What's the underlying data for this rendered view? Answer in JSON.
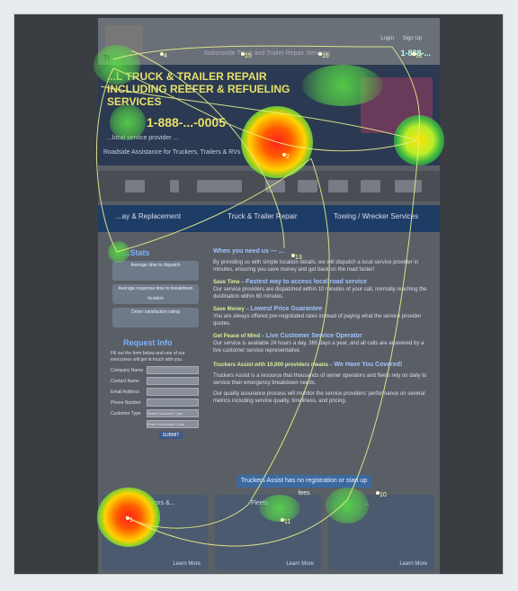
{
  "header": {
    "logo_text": "Tr",
    "login": "Login",
    "signup": "Sign Up",
    "tagline": "Nationwide Truck and Trailer Repair Services",
    "phone": "1-888-..."
  },
  "hero": {
    "title_line1": "...L TRUCK & TRAILER REPAIR",
    "title_line2": "INCLUDING REEFER & REFUELING SERVICES",
    "phone": "1-888-...-0005",
    "sub": "...local service provider ...",
    "road": "Roadside Assistance for Truckers, Trailers & RVs"
  },
  "services": {
    "item1": "...ay & Replacement",
    "item2": "Truck & Trailer Repair",
    "item3": "Towing / Wrecker Services"
  },
  "sidebar": {
    "stats_title": "...Stats",
    "stat1": "Average time to dispatch",
    "stat2": "Average response time to breakdown location",
    "stat3": "Driver satisfaction rating",
    "request_title": "Request Info",
    "request_note": "Fill out the form below and one of our executives will get in touch with you.",
    "fields": [
      "Company Name",
      "Contact Name",
      "Email Address",
      "Phone Number",
      "Customer Type"
    ],
    "select_value": "Select Customer Type",
    "captcha": "Enter Verification Code",
    "submit": "SUBMIT"
  },
  "content": {
    "heading": "When you need us — ...",
    "intro": "By providing us with simple location details, we will dispatch a local service provider in minutes, ensuring you save money and get back on the road faster!",
    "b1_title": "Save Time",
    "b1_link": "Fastest way to access local road service",
    "b1_text": "Our service providers are dispatched within 10 minutes of your call, normally reaching the destination within 60 minutes.",
    "b2_title": "Save Money",
    "b2_link": "Lowest Price Guarantee",
    "b2_text": "You are always offered pre-negotiated rates instead of paying what the service provider quotes.",
    "b3_title": "Get Peace of Mind",
    "b3_link": "Live Customer Service Operator",
    "b3_text": "Our service is available 24 hours a day, 365 days a year, and all calls are answered by a live customer service representative.",
    "truckers": "Truckers Assist with 10,000 providers means",
    "truckers_link": "We Have You Covered!",
    "p1": "Truckers Assist is a resource that thousands of owner operators and fleets rely on daily to service their emergency breakdown needs.",
    "p2": "Our quality assurance process will monitor the service providers' performance on several metrics including service quality, timeliness, and pricing.",
    "cta": "Truckers Assist has no registration or start up fees"
  },
  "footer": {
    "col1_title": "...r Operators &...",
    "col2_title": "Fleets",
    "col3_title": "...",
    "learn_more": "Learn More"
  },
  "fixations": [
    "4",
    "15",
    "16",
    "12",
    "13",
    "2",
    "1",
    "11",
    "10"
  ]
}
